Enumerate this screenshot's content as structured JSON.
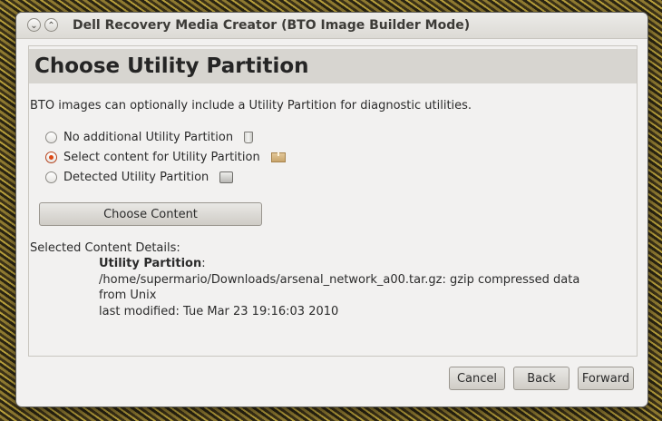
{
  "window": {
    "title": "Dell Recovery Media Creator (BTO Image Builder Mode)",
    "minimize_glyph": "⌄",
    "maximize_glyph": "⌃"
  },
  "page": {
    "title": "Choose Utility Partition",
    "description": "BTO images can optionally include a Utility Partition for diagnostic utilities."
  },
  "options": [
    {
      "label": "No additional Utility Partition",
      "checked": false,
      "icon": "trash-icon"
    },
    {
      "label": "Select content for Utility Partition",
      "checked": true,
      "icon": "package-icon"
    },
    {
      "label": "Detected Utility Partition",
      "checked": false,
      "icon": "harddisk-icon"
    }
  ],
  "choose_content_label": "Choose Content",
  "details": {
    "label": "Selected Content Details:",
    "heading": "Utility Partition",
    "heading_suffix": ":",
    "path_line": "/home/supermario/Downloads/arsenal_network_a00.tar.gz: gzip compressed data",
    "from_line": "from Unix",
    "modified_line": "last modified: Tue Mar 23 19:16:03 2010"
  },
  "buttons": {
    "cancel": "Cancel",
    "back": "Back",
    "forward": "Forward"
  },
  "colors": {
    "accent": "#dd4814",
    "header_band": "#d7d5d0",
    "window_bg": "#f2f1f0"
  }
}
